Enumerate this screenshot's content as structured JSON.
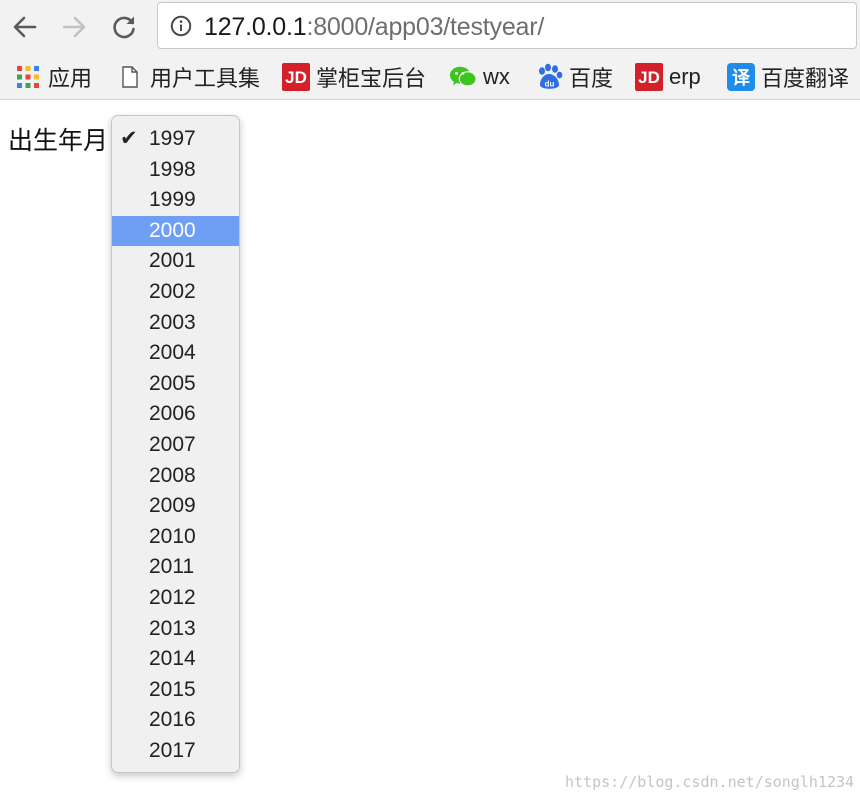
{
  "browser": {
    "url_host": "127.0.0.1",
    "url_rest": ":8000/app03/testyear/",
    "bookmarks": [
      {
        "icon": "apps-grid-icon",
        "label": "应用"
      },
      {
        "icon": "document-icon",
        "label": "用户工具集"
      },
      {
        "icon": "jd-logo-icon",
        "icon_text": "JD",
        "label": "掌柜宝后台"
      },
      {
        "icon": "wechat-icon",
        "label": "wx"
      },
      {
        "icon": "baidu-paw-icon",
        "icon_text": "du",
        "label": "百度"
      },
      {
        "icon": "jd-logo-icon",
        "icon_text": "JD",
        "label": "erp"
      },
      {
        "icon": "translate-icon",
        "icon_text": "译",
        "label": "百度翻译"
      }
    ]
  },
  "page": {
    "field_label": "出生年月",
    "select": {
      "selected_value": "1997",
      "highlighted_value": "2000",
      "options": [
        "1997",
        "1998",
        "1999",
        "2000",
        "2001",
        "2002",
        "2003",
        "2004",
        "2005",
        "2006",
        "2007",
        "2008",
        "2009",
        "2010",
        "2011",
        "2012",
        "2013",
        "2014",
        "2015",
        "2016",
        "2017"
      ]
    }
  },
  "watermark": "https://blog.csdn.net/songlh1234",
  "colors": {
    "highlight": "#6f9ff5",
    "jd_red": "#d3202b",
    "wechat_green": "#3ec31f",
    "baidu_blue": "#2d6fe0",
    "translate_blue": "#1f8de8"
  }
}
